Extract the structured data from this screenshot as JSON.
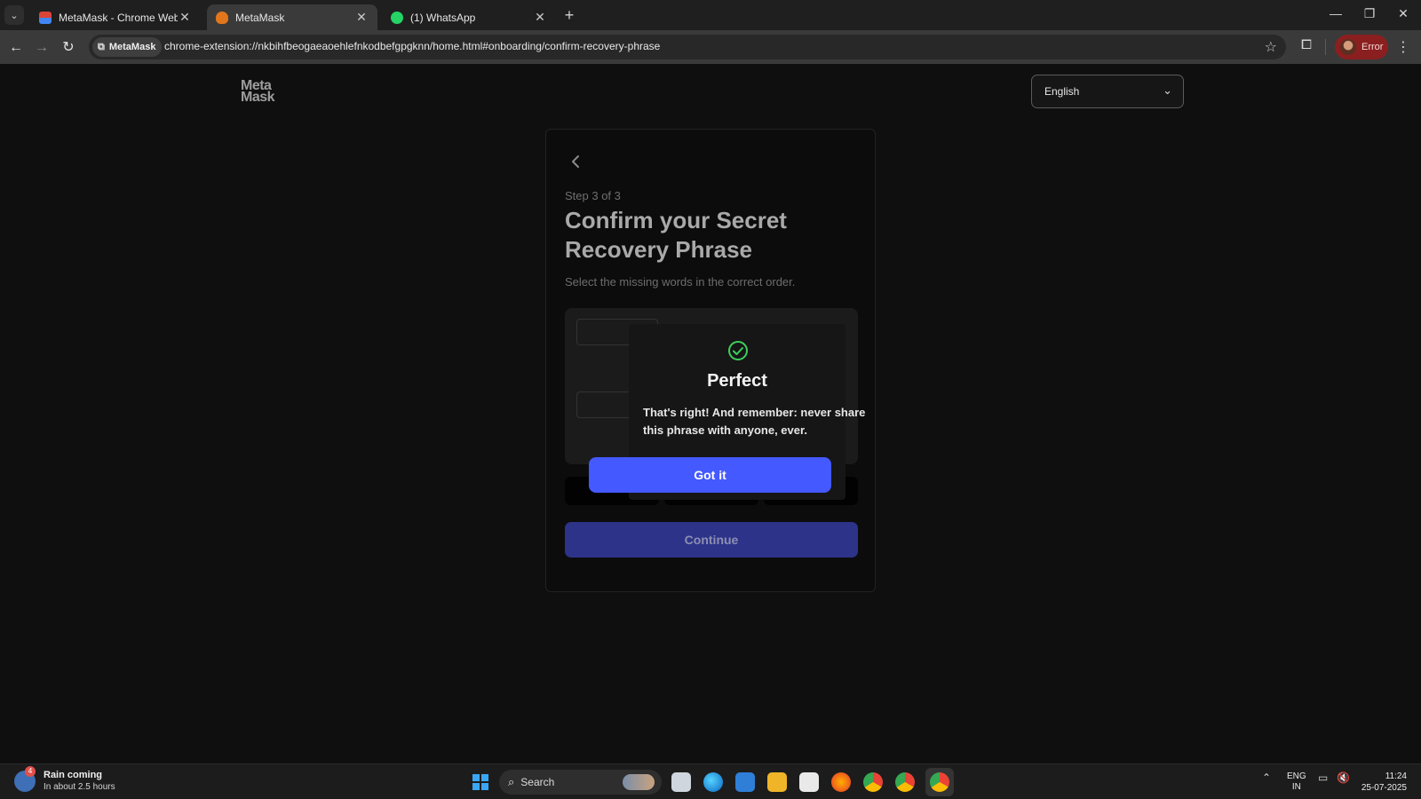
{
  "browser": {
    "tabs": [
      {
        "title": "MetaMask - Chrome Web Store",
        "active": false,
        "favicon": "chrome-web-store-icon"
      },
      {
        "title": "MetaMask",
        "active": true,
        "favicon": "metamask-fox-icon"
      },
      {
        "title": "(1) WhatsApp",
        "active": false,
        "favicon": "whatsapp-icon"
      }
    ],
    "site_chip": "MetaMask",
    "url": "chrome-extension://nkbihfbeogaeaoehlefnkodbefgpgknn/home.html#onboarding/confirm-recovery-phrase",
    "profile_status": "Error"
  },
  "header": {
    "logo_line1": "Meta",
    "logo_line2": "Mask",
    "language": "English"
  },
  "onboarding": {
    "step": "Step 3 of 3",
    "title": "Confirm your Secret Recovery Phrase",
    "subtitle": "Select the missing words in the correct order.",
    "continue_label": "Continue"
  },
  "modal": {
    "title": "Perfect",
    "body": "That's right! And remember: never share this phrase with anyone, ever.",
    "button_label": "Got it"
  },
  "taskbar": {
    "weather_title": "Rain coming",
    "weather_sub": "In about 2.5 hours",
    "weather_badge": "4",
    "search_label": "Search",
    "lang_line1": "ENG",
    "lang_line2": "IN",
    "time": "11:24",
    "date": "25-07-2025"
  },
  "colors": {
    "accent_button": "#4459ff",
    "continue_button": "#2d3389",
    "check_green": "#3ecf5b",
    "profile_error": "#8b1f1f"
  }
}
